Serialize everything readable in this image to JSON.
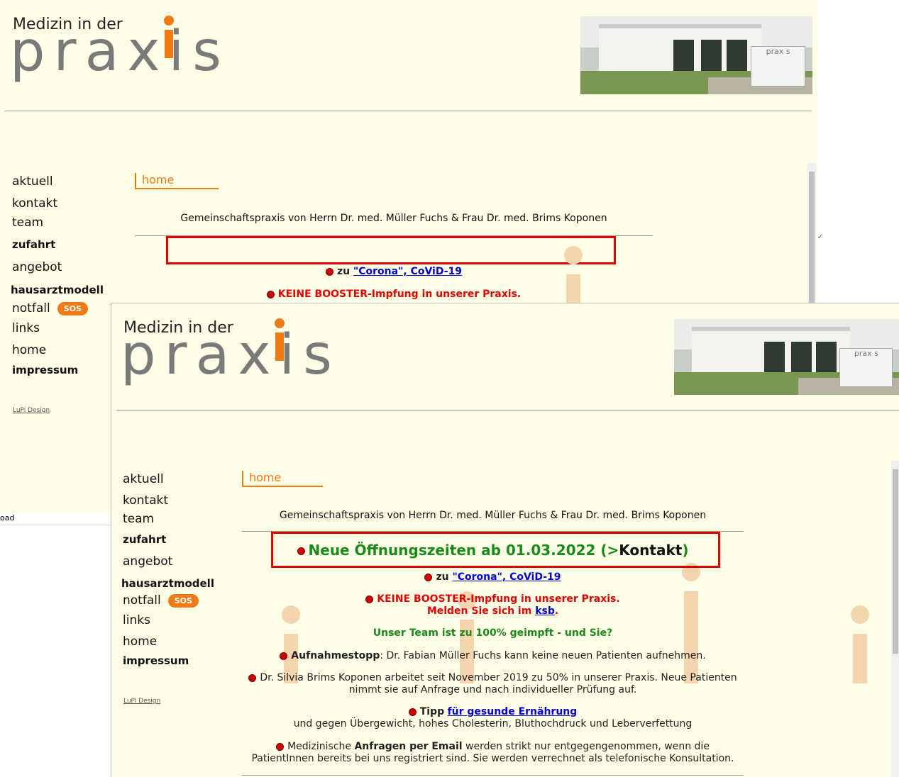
{
  "logo": {
    "small": "Medizin in der",
    "big": "praxis",
    "sign_text": "prax s"
  },
  "nav": {
    "items": [
      "aktuell",
      "kontakt",
      "team",
      "zufahrt",
      "angebot",
      "hausarztmodell",
      "notfall",
      "links",
      "home",
      "impressum"
    ],
    "sos": "SOS",
    "designer": "LuPi Design"
  },
  "tab": "home",
  "intro": "Gemeinschaftspraxis von Herrn Dr. med. Müller Fuchs & Frau Dr. med. Brims Koponen",
  "strip_text": "oad",
  "news": {
    "hours_a": "Neue Öffnungszeiten ab 01.03.2022 (>",
    "hours_link": "Kontakt",
    "hours_b": ")",
    "corona_prefix": "zu ",
    "corona_link": "\"Corona\", CoViD-19",
    "booster": "KEINE BOOSTER-Impfung in unserer Praxis.",
    "register_prefix": "Melden Sie sich im ",
    "register_link": "ksb",
    "register_suffix": ".",
    "vaccinated": "Unser Team ist zu 100% geimpft - und Sie?",
    "stop_label": "Aufnahmestopp",
    "stop_text": ": Dr. Fabian Müller Fuchs kann keine neuen Patienten aufnehmen.",
    "brims_1": "Dr. Silvia Brims Koponen arbeitet seit November 2019 zu 50% in unserer Praxis. Neue Patienten",
    "brims_2": "nimmt sie auf Anfrage und nach individueller Prüfung auf.",
    "tipp_label": "Tipp",
    "tipp_link": "für gesunde Ernährung",
    "tipp_text": "und gegen Übergewicht, hohes Cholesterin, Bluthochdruck und Leberverfettung",
    "email_prefix": "Medizinische ",
    "email_bold": "Anfragen per Email",
    "email_text_1": " werden strikt nur entgegengenommen, wenn die",
    "email_text_2": "PatientInnen bereits bei uns registriert sind. Sie werden verrechnet als telefonische Konsultation."
  },
  "colors": {
    "accent": "#f07a14",
    "highlight": "#e00000",
    "green": "#1a8a1a",
    "link": "#0000d0",
    "background": "#ffffe8"
  }
}
